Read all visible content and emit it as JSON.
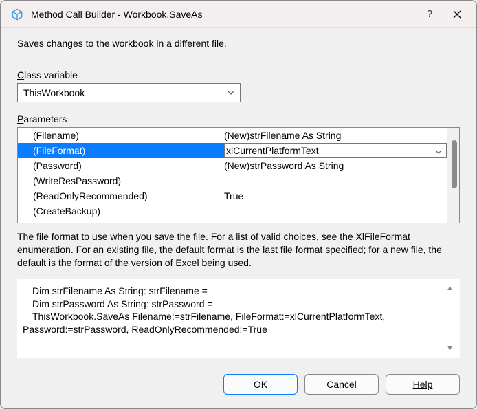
{
  "title": "Method Call Builder - Workbook.SaveAs",
  "description": "Saves changes to the workbook in a different file.",
  "classVarLabel": "Class variable",
  "classVarValue": "ThisWorkbook",
  "parametersLabel": "Parameters",
  "params": [
    {
      "name": "(Filename)",
      "value": "(New)strFilename As String"
    },
    {
      "name": "(FileFormat)",
      "value": "xlCurrentPlatformText"
    },
    {
      "name": "(Password)",
      "value": "(New)strPassword As String"
    },
    {
      "name": "(WriteResPassword)",
      "value": ""
    },
    {
      "name": "(ReadOnlyRecommended)",
      "value": "True"
    },
    {
      "name": "(CreateBackup)",
      "value": ""
    }
  ],
  "selectedParamIndex": 1,
  "paramHelp": "The file format to use when you save the file. For a list of valid choices, see the XlFileFormat enumeration. For an existing file, the default format is the last file format specified; for a new file, the default is the format of the version of Excel being used.",
  "code": {
    "line1": "Dim strFilename As String: strFilename =",
    "line2": "Dim strPassword As String: strPassword =",
    "line3": "ThisWorkbook.SaveAs Filename:=strFilename, FileFormat:=xlCurrentPlatformText,",
    "line4": "Password:=strPassword, ReadOnlyRecommended:=True"
  },
  "buttons": {
    "ok": "OK",
    "cancel": "Cancel",
    "help": "Help"
  }
}
